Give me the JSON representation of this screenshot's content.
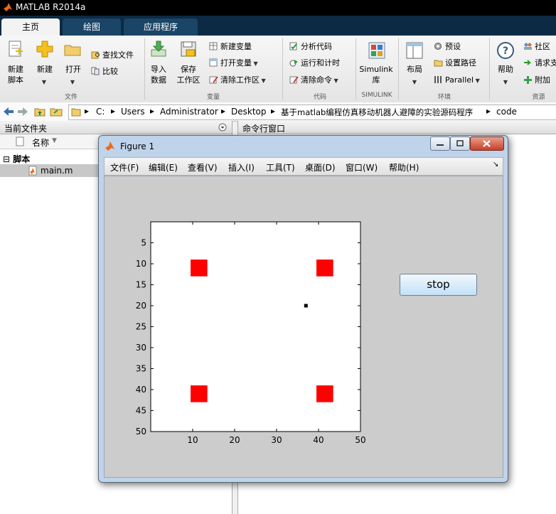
{
  "app": {
    "title": "MATLAB R2014a"
  },
  "tabs": [
    {
      "label": "主页",
      "active": true
    },
    {
      "label": "绘图",
      "active": false
    },
    {
      "label": "应用程序",
      "active": false
    }
  ],
  "ribbon": {
    "file": {
      "new_script": "新建\n脚本",
      "new": "新建",
      "open": "打开",
      "find_files": "查找文件",
      "compare": "比较",
      "section": "文件"
    },
    "variable": {
      "import_data": "导入\n数据",
      "save_workspace": "保存\n工作区",
      "new_variable": "新建变量",
      "open_variable": "打开变量",
      "clear_workspace": "清除工作区",
      "section": "变量"
    },
    "code": {
      "analyze": "分析代码",
      "run_time": "运行和计时",
      "clear_commands": "清除命令",
      "section": "代码"
    },
    "simulink": {
      "library": "Simulink\n库",
      "section": "SIMULINK"
    },
    "environment": {
      "layout": "布局",
      "preferences": "预设",
      "set_path": "设置路径",
      "parallel": "Parallel",
      "section": "环境"
    },
    "resources": {
      "help": "帮助",
      "community": "社区",
      "request_support": "请求支",
      "addons": "附加",
      "section": "资源"
    }
  },
  "address": {
    "crumbs": [
      "C:",
      "Users",
      "Administrator",
      "Desktop",
      "基于matlab编程仿真移动机器人避障的实验源码程序",
      "code"
    ]
  },
  "current_folder": {
    "title": "当前文件夹",
    "column_name": "名称",
    "group": "脚本",
    "file": "main.m"
  },
  "command_window": {
    "title": "命令行窗口"
  },
  "figure": {
    "title": "Figure 1",
    "menus": [
      "文件(F)",
      "编辑(E)",
      "查看(V)",
      "插入(I)",
      "工具(T)",
      "桌面(D)",
      "窗口(W)",
      "帮助(H)"
    ],
    "stop_label": "stop"
  },
  "colors": {
    "obstacle": "#ff0000",
    "robot": "#000000",
    "ribbon_tabbar": "#0d2a44"
  },
  "chart_data": {
    "type": "scatter",
    "xlim": [
      0,
      50
    ],
    "ylim": [
      0,
      50
    ],
    "y_reversed": true,
    "x_ticks": [
      10,
      20,
      30,
      40,
      50
    ],
    "y_ticks": [
      5,
      10,
      15,
      20,
      25,
      30,
      35,
      40,
      45,
      50
    ],
    "obstacles": [
      {
        "x": 11.5,
        "y": 11
      },
      {
        "x": 41.5,
        "y": 11
      },
      {
        "x": 11.5,
        "y": 41
      },
      {
        "x": 41.5,
        "y": 41
      }
    ],
    "obstacle_size": [
      4,
      4
    ],
    "robot": {
      "x": 37,
      "y": 20
    },
    "grid": false
  }
}
